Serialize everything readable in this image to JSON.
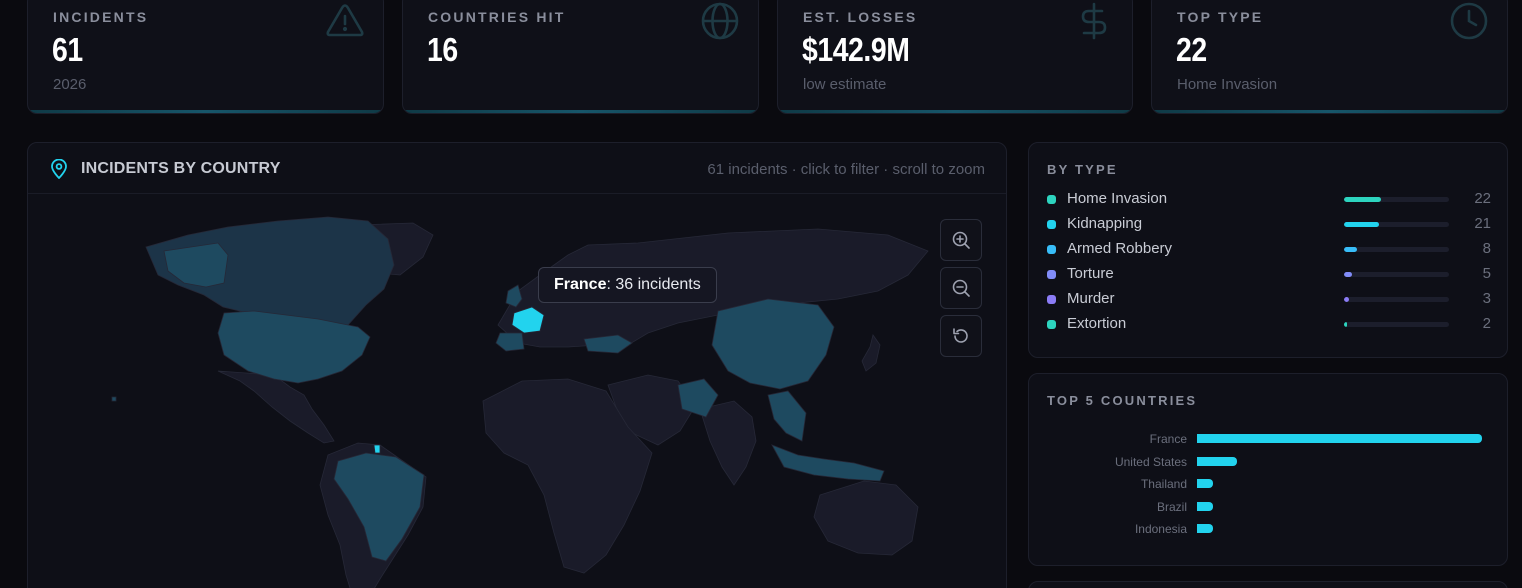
{
  "stats": [
    {
      "label": "INCIDENTS",
      "value": "61",
      "sub": "2026",
      "icon": "warning-triangle-icon"
    },
    {
      "label": "COUNTRIES HIT",
      "value": "16",
      "sub": "",
      "icon": "globe-icon"
    },
    {
      "label": "EST. LOSSES",
      "value": "$142.9M",
      "sub": "low estimate",
      "icon": "dollar-icon"
    },
    {
      "label": "TOP TYPE",
      "value": "22",
      "sub": "Home Invasion",
      "icon": "clock-icon"
    }
  ],
  "map_panel": {
    "title": "INCIDENTS BY COUNTRY",
    "hint": "61 incidents · click to filter · scroll to zoom",
    "tooltip": {
      "country": "France",
      "text": ": 36 incidents"
    },
    "controls": [
      "zoom-in-icon",
      "zoom-out-icon",
      "reset-icon"
    ]
  },
  "by_type": {
    "title": "BY TYPE",
    "max": 22,
    "items": [
      {
        "label": "Home Invasion",
        "count": 22,
        "color": "#2dd4bf"
      },
      {
        "label": "Kidnapping",
        "count": 21,
        "color": "#22d3ee"
      },
      {
        "label": "Armed Robbery",
        "count": 8,
        "color": "#38bdf8"
      },
      {
        "label": "Torture",
        "count": 5,
        "color": "#818cf8"
      },
      {
        "label": "Murder",
        "count": 3,
        "color": "#8b7cf6"
      },
      {
        "label": "Extortion",
        "count": 2,
        "color": "#2dd4bf"
      }
    ]
  },
  "top_countries": {
    "title": "TOP 5 COUNTRIES",
    "chart_data": {
      "type": "bar",
      "orientation": "horizontal",
      "categories": [
        "France",
        "United States",
        "Thailand",
        "Brazil",
        "Indonesia"
      ],
      "values": [
        36,
        5,
        2,
        2,
        2
      ]
    }
  },
  "colors": {
    "accent": "#22d3ee",
    "highlight_country": "#22d3ee",
    "shaded_country": "#1e4a60",
    "land": "#1a1b29"
  }
}
